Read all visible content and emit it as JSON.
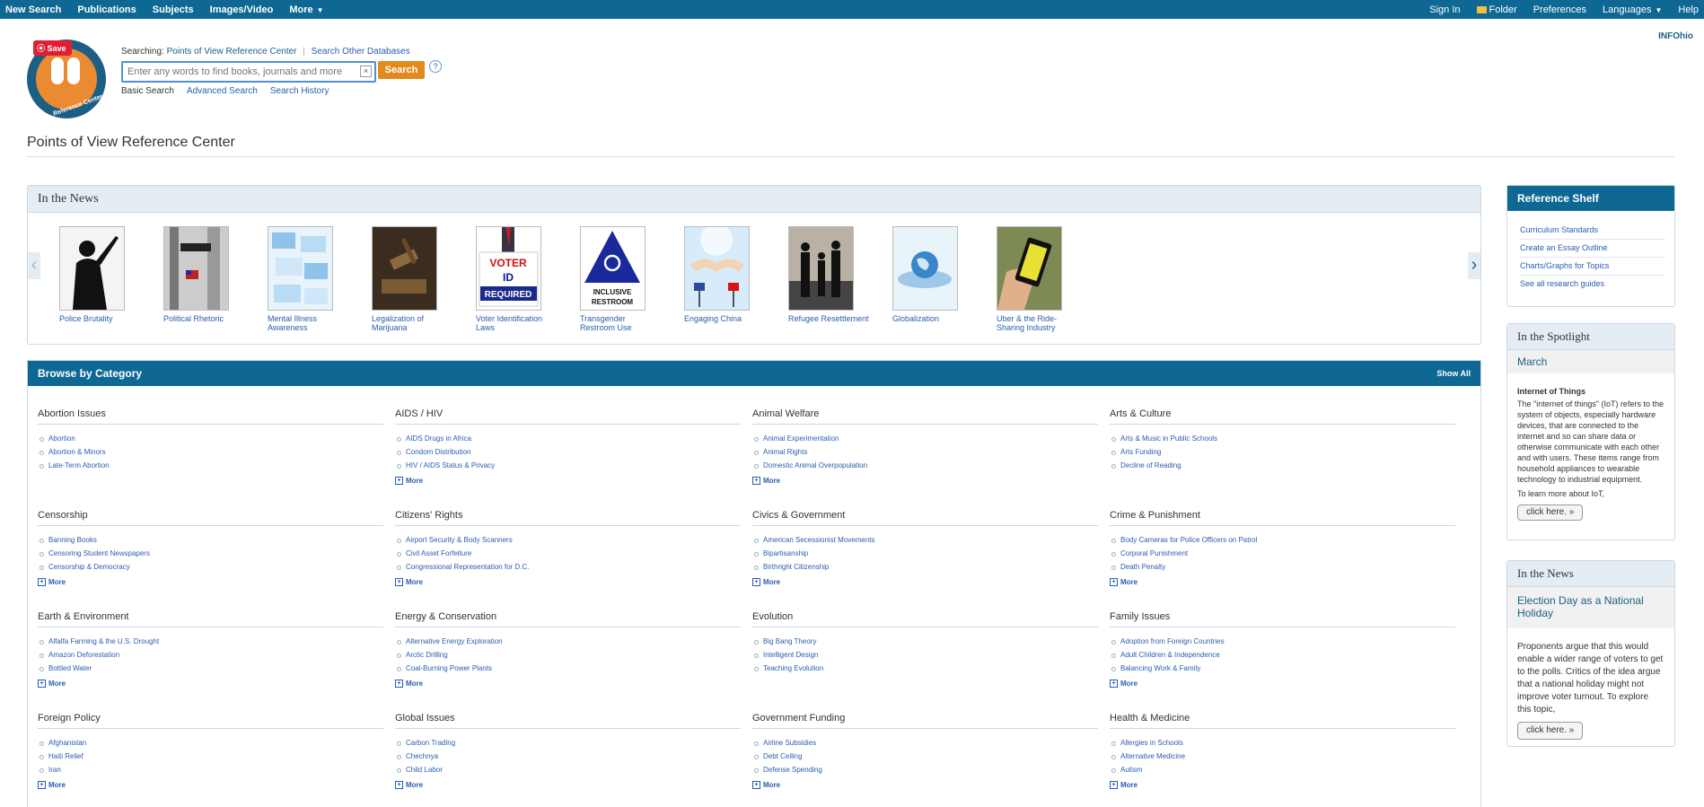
{
  "topbar": {
    "left": [
      "New Search",
      "Publications",
      "Subjects",
      "Images/Video",
      "More"
    ],
    "right": [
      "Sign In",
      "Folder",
      "Preferences",
      "Languages",
      "Help"
    ]
  },
  "logo": {
    "save_label": "Save",
    "ring_text": "Reference Center"
  },
  "search": {
    "searching_label": "Searching:",
    "database": "Points of View Reference Center",
    "other_link": "Search Other Databases",
    "placeholder": "Enter any words to find books, journals and more",
    "button": "Search",
    "help": "?",
    "modes": [
      "Basic Search",
      "Advanced Search",
      "Search History"
    ]
  },
  "org": "INFOhio",
  "page_title": "Points of View Reference Center",
  "in_the_news": {
    "title": "In the News",
    "items": [
      {
        "label": "Police Brutality",
        "thumb": "police-silhouette"
      },
      {
        "label": "Political Rhetoric",
        "thumb": "democracy-sign"
      },
      {
        "label": "Mental Illness Awareness",
        "thumb": "sticky-notes"
      },
      {
        "label": "Legalization of Marijuana",
        "thumb": "gavel"
      },
      {
        "label": "Voter Identification Laws",
        "thumb": "voter-id-sign",
        "sign": [
          "VOTER",
          "ID",
          "REQUIRED"
        ]
      },
      {
        "label": "Transgender Restroom Use",
        "thumb": "restroom-sign",
        "sign": [
          "INCLUSIVE",
          "RESTROOM"
        ]
      },
      {
        "label": "Engaging China",
        "thumb": "handshake-flags"
      },
      {
        "label": "Refugee Resettlement",
        "thumb": "refugee-family"
      },
      {
        "label": "Globalization",
        "thumb": "globe"
      },
      {
        "label": "Uber & the Ride-Sharing Industry",
        "thumb": "phone-hand"
      }
    ]
  },
  "browse": {
    "title": "Browse by Category",
    "show_all": "Show All",
    "more_label": "More",
    "categories": [
      {
        "title": "Abortion Issues",
        "items": [
          "Abortion",
          "Abortion & Minors",
          "Late-Term Abortion"
        ],
        "more": false
      },
      {
        "title": "AIDS / HIV",
        "items": [
          "AIDS Drugs in Africa",
          "Condom Distribution",
          "HIV / AIDS Status & Privacy"
        ],
        "more": true
      },
      {
        "title": "Animal Welfare",
        "items": [
          "Animal Experimentation",
          "Animal Rights",
          "Domestic Animal Overpopulation"
        ],
        "more": true
      },
      {
        "title": "Arts & Culture",
        "items": [
          "Arts & Music in Public Schools",
          "Arts Funding",
          "Decline of Reading"
        ],
        "more": false
      },
      {
        "title": "Censorship",
        "items": [
          "Banning Books",
          "Censoring Student Newspapers",
          "Censorship & Democracy"
        ],
        "more": true
      },
      {
        "title": "Citizens' Rights",
        "items": [
          "Airport Security & Body Scanners",
          "Civil Asset Forfeiture",
          "Congressional Representation for D.C."
        ],
        "more": true
      },
      {
        "title": "Civics & Government",
        "items": [
          "American Secessionist Movements",
          "Bipartisanship",
          "Birthright Citizenship"
        ],
        "more": true
      },
      {
        "title": "Crime & Punishment",
        "items": [
          "Body Cameras for Police Officers on Patrol",
          "Corporal Punishment",
          "Death Penalty"
        ],
        "more": true
      },
      {
        "title": "Earth & Environment",
        "items": [
          "Alfalfa Farming & the U.S. Drought",
          "Amazon Deforestation",
          "Bottled Water"
        ],
        "more": true
      },
      {
        "title": "Energy & Conservation",
        "items": [
          "Alternative Energy Exploration",
          "Arctic Drilling",
          "Coal-Burning Power Plants"
        ],
        "more": true
      },
      {
        "title": "Evolution",
        "items": [
          "Big Bang Theory",
          "Intelligent Design",
          "Teaching Evolution"
        ],
        "more": false
      },
      {
        "title": "Family Issues",
        "items": [
          "Adoption from Foreign Countries",
          "Adult Children & Independence",
          "Balancing Work & Family"
        ],
        "more": true
      },
      {
        "title": "Foreign Policy",
        "items": [
          "Afghanistan",
          "Haiti Relief",
          "Iran"
        ],
        "more": true
      },
      {
        "title": "Global Issues",
        "items": [
          "Carbon Trading",
          "Chechnya",
          "Child Labor"
        ],
        "more": true
      },
      {
        "title": "Government Funding",
        "items": [
          "Airline Subsidies",
          "Debt Ceiling",
          "Defense Spending"
        ],
        "more": true
      },
      {
        "title": "Health & Medicine",
        "items": [
          "Allergies in Schools",
          "Alternative Medicine",
          "Autism"
        ],
        "more": true
      }
    ]
  },
  "reference_shelf": {
    "title": "Reference Shelf",
    "links": [
      "Curriculum Standards",
      "Create an Essay Outline",
      "Charts/Graphs for Topics",
      "See all research guides"
    ]
  },
  "spotlight": {
    "title": "In the Spotlight",
    "month": "March",
    "topic": "Internet of Things",
    "text": "The \"internet of things\" (IoT) refers to the system of objects, especially hardware devices, that are connected to the internet and so can share data or otherwise communicate with each other and with users. These items range from household appliances to wearable technology to industrial equipment.",
    "cta": "To learn more about IoT,",
    "button": "click here. »"
  },
  "side_news": {
    "title": "In the News",
    "headline": "Election Day as a National Holiday",
    "text": "Proponents argue that this would enable a wider range of voters to get to the polls. Critics of the idea argue that a national holiday might not improve voter turnout. To explore this topic,",
    "button": "click here. »"
  },
  "colors": {
    "brand": "#0e6893",
    "accent": "#e28a1e",
    "link": "#2a5db0",
    "panel": "#e5edf4"
  }
}
